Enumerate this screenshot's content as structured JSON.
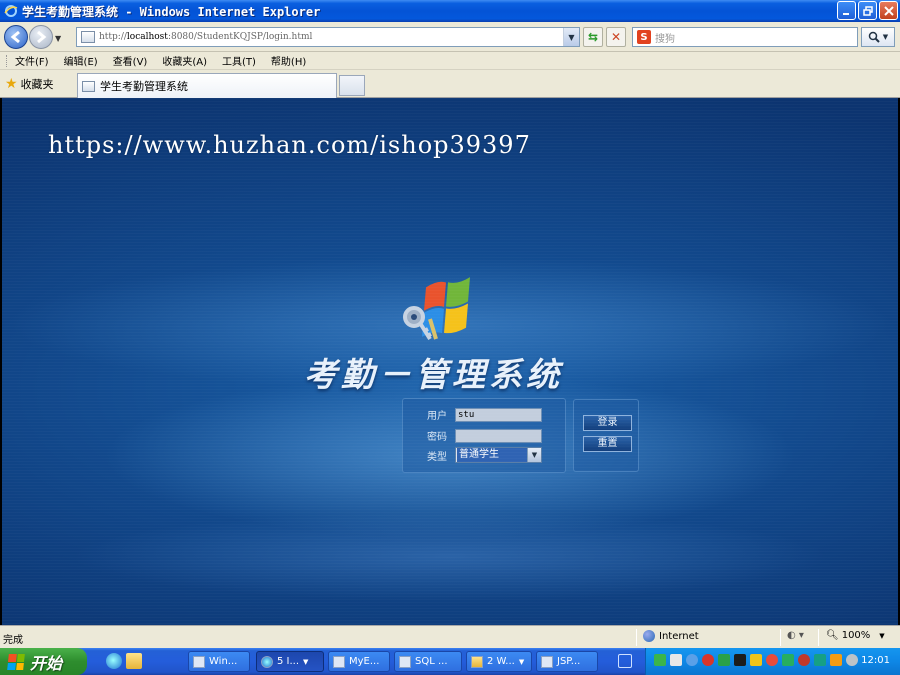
{
  "window": {
    "title": "学生考勤管理系统 - Windows Internet Explorer"
  },
  "address_bar": {
    "url_prefix": "http://",
    "url_host": "localhost",
    "url_rest": ":8080/StudentKQJSP/login.html",
    "search_placeholder": "搜狗"
  },
  "menu": {
    "items": [
      "文件(F)",
      "编辑(E)",
      "查看(V)",
      "收藏夹(A)",
      "工具(T)",
      "帮助(H)"
    ]
  },
  "favorites": {
    "label": "收藏夹"
  },
  "tabs": [
    {
      "label": "学生考勤管理系统"
    }
  ],
  "page": {
    "watermark": "https://www.huzhan.com/ishop39397",
    "system_title": "考勤－管理系统",
    "login": {
      "user_label": "用户",
      "user_value": "stu",
      "password_label": "密码",
      "password_value": "",
      "type_label": "类型",
      "type_selected": "普通学生",
      "login_button": "登录",
      "reset_button": "重置"
    }
  },
  "status_bar": {
    "text": "完成",
    "zone": "Internet",
    "zoom": "100%"
  },
  "taskbar": {
    "start_label": "开始",
    "tasks": [
      {
        "label": "Win..."
      },
      {
        "label": "5 I..."
      },
      {
        "label": "MyE..."
      },
      {
        "label": "SQL ..."
      },
      {
        "label": "2 W..."
      },
      {
        "label": "JSP..."
      }
    ],
    "clock": "12:01"
  },
  "colors": {
    "title_bar": "#0453d6",
    "page_background": "#124a8e",
    "start_button": "#2e8d2e"
  }
}
